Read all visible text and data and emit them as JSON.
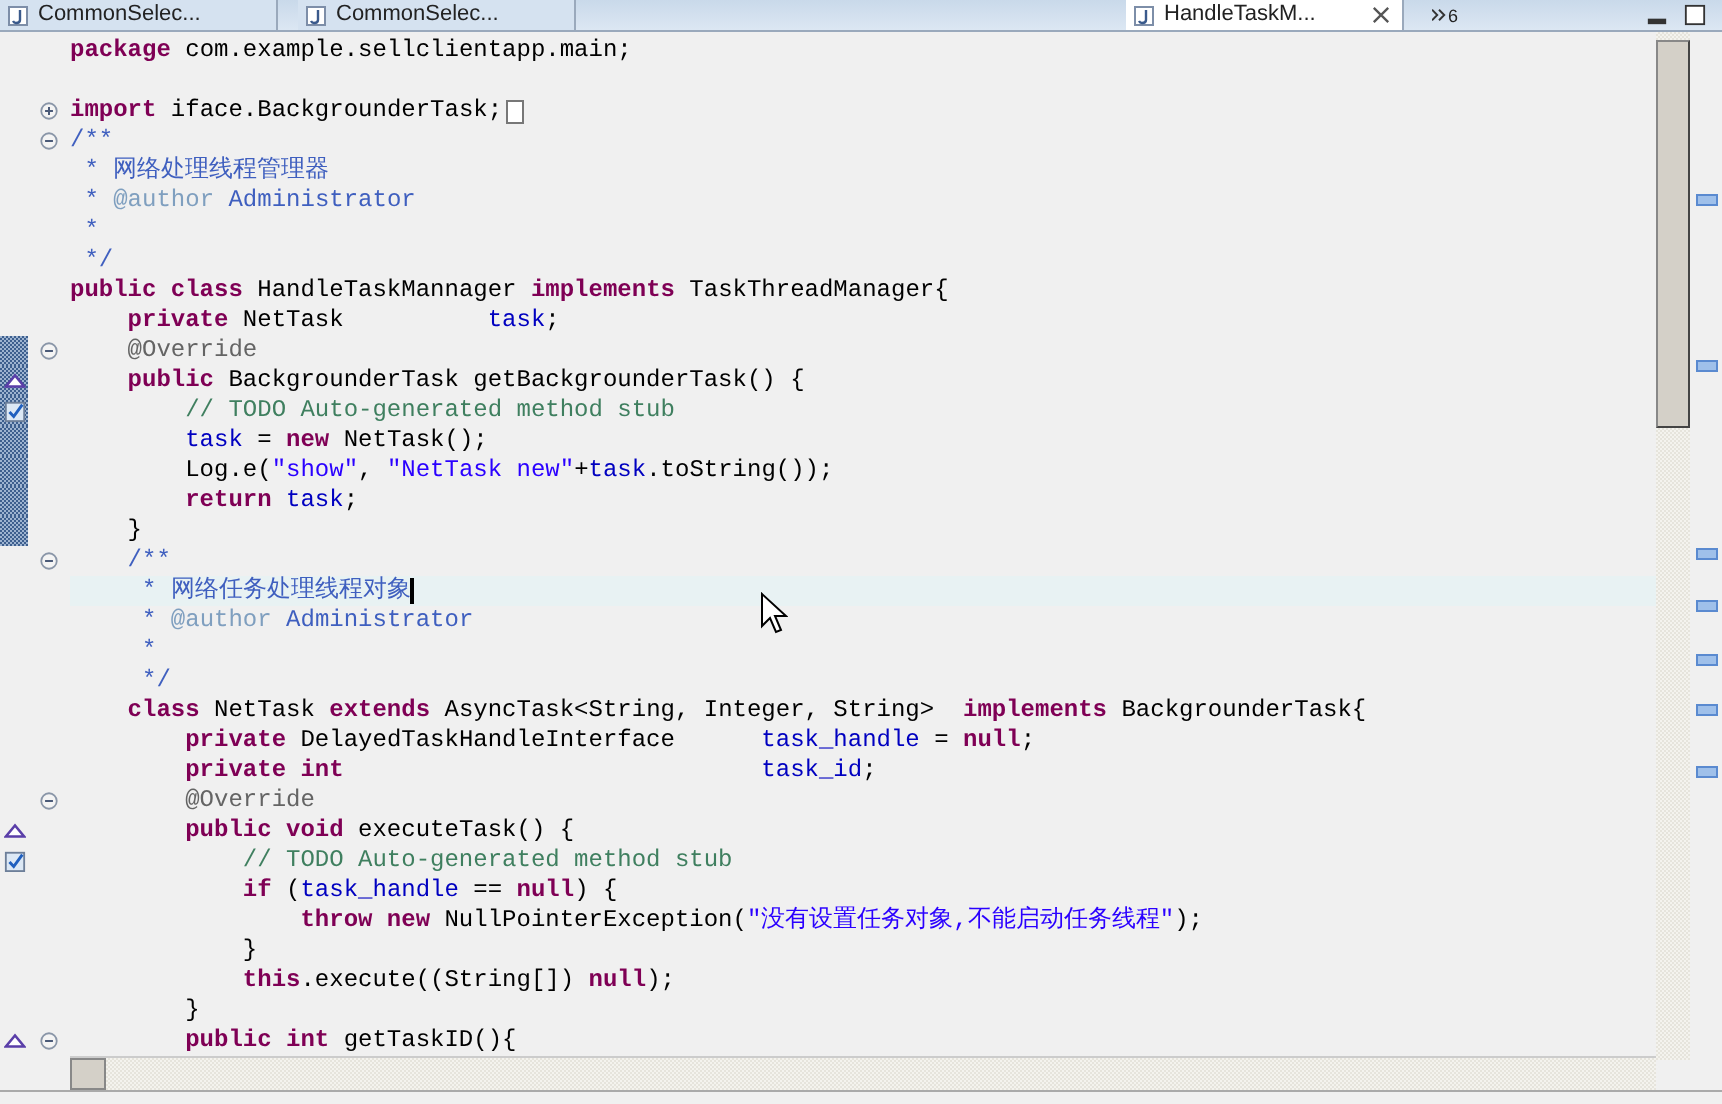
{
  "tabs": [
    {
      "label": "CommonSelec...",
      "selected": false
    },
    {
      "label": "CommonSelec...",
      "selected": false
    },
    {
      "label": "HandleTaskM...",
      "selected": true
    }
  ],
  "hidden_tab_count": "6",
  "lines": [
    {
      "changed": false,
      "current": false,
      "tokens": [
        {
          "kind": "kw",
          "text": "package"
        },
        {
          "kind": "plain",
          "text": " com.example.sellclientapp.main;"
        }
      ]
    },
    {
      "changed": false,
      "current": false
    },
    {
      "changed": false,
      "current": false,
      "folded": true,
      "tokens": [
        {
          "kind": "kw",
          "text": "import"
        },
        {
          "kind": "plain",
          "text": " iface.BackgrounderTask;"
        }
      ]
    },
    {
      "changed": false,
      "current": false,
      "folded": false,
      "tokens": [
        {
          "kind": "javadoc",
          "text": "/**"
        }
      ]
    },
    {
      "changed": false,
      "current": false,
      "tokens": [
        {
          "kind": "javadoc",
          "text": " * 网络处理线程管理器"
        }
      ]
    },
    {
      "changed": false,
      "current": false,
      "tokens": [
        {
          "kind": "javadoc",
          "text": " * "
        },
        {
          "kind": "tag",
          "text": "@author"
        },
        {
          "kind": "javadoc",
          "text": " Administrator"
        }
      ]
    },
    {
      "changed": false,
      "current": false,
      "tokens": [
        {
          "kind": "javadoc",
          "text": " *"
        }
      ]
    },
    {
      "changed": false,
      "current": false,
      "tokens": [
        {
          "kind": "javadoc",
          "text": " */"
        }
      ]
    },
    {
      "changed": false,
      "current": false,
      "tokens": [
        {
          "kind": "kw",
          "text": "public class"
        },
        {
          "kind": "plain",
          "text": " HandleTaskMannager "
        },
        {
          "kind": "kw",
          "text": "implements"
        },
        {
          "kind": "plain",
          "text": " TaskThreadManager{"
        }
      ]
    },
    {
      "changed": false,
      "current": false,
      "tokens": [
        {
          "kind": "kw",
          "text": "    private"
        },
        {
          "kind": "plain",
          "text": " NetTask          "
        },
        {
          "kind": "field",
          "text": "task"
        },
        {
          "kind": "plain",
          "text": ";"
        }
      ]
    },
    {
      "changed": true,
      "current": false,
      "folded": false,
      "tokens": [
        {
          "kind": "annotation",
          "text": "    @Override"
        }
      ]
    },
    {
      "changed": true,
      "current": false,
      "marker": {
        "kind": "override"
      },
      "tokens": [
        {
          "kind": "kw",
          "text": "    public"
        },
        {
          "kind": "plain",
          "text": " BackgrounderTask getBackgrounderTask() {"
        }
      ]
    },
    {
      "changed": true,
      "current": false,
      "marker": {
        "kind": "task"
      },
      "tokens": [
        {
          "kind": "comment",
          "text": "        // TODO Auto-generated method stub"
        }
      ]
    },
    {
      "changed": true,
      "current": false,
      "tokens": [
        {
          "kind": "field",
          "text": "        task"
        },
        {
          "kind": "plain",
          "text": " = "
        },
        {
          "kind": "kw",
          "text": "new"
        },
        {
          "kind": "plain",
          "text": " NetTask();"
        }
      ]
    },
    {
      "changed": true,
      "current": false,
      "tokens": [
        {
          "kind": "plain",
          "text": "        Log.e("
        },
        {
          "kind": "string",
          "text": "\"show\""
        },
        {
          "kind": "plain",
          "text": ", "
        },
        {
          "kind": "string",
          "text": "\"NetTask new\""
        },
        {
          "kind": "plain",
          "text": "+"
        },
        {
          "kind": "field",
          "text": "task"
        },
        {
          "kind": "plain",
          "text": ".toString());"
        }
      ]
    },
    {
      "changed": true,
      "current": false,
      "tokens": [
        {
          "kind": "kw",
          "text": "        return"
        },
        {
          "kind": "field",
          "text": " task"
        },
        {
          "kind": "plain",
          "text": ";"
        }
      ]
    },
    {
      "changed": true,
      "current": false,
      "tokens": [
        {
          "kind": "plain",
          "text": "    }"
        }
      ]
    },
    {
      "changed": false,
      "current": false,
      "folded": false,
      "tokens": [
        {
          "kind": "javadoc",
          "text": "    /**"
        }
      ]
    },
    {
      "changed": false,
      "current": true,
      "tokens": [
        {
          "kind": "javadoc",
          "text": "     * 网络任务处理线程对象"
        }
      ]
    },
    {
      "changed": false,
      "current": false,
      "tokens": [
        {
          "kind": "javadoc",
          "text": "     * "
        },
        {
          "kind": "tag",
          "text": "@author"
        },
        {
          "kind": "javadoc",
          "text": " Administrator"
        }
      ]
    },
    {
      "changed": false,
      "current": false,
      "tokens": [
        {
          "kind": "javadoc",
          "text": "     *"
        }
      ]
    },
    {
      "changed": false,
      "current": false,
      "tokens": [
        {
          "kind": "javadoc",
          "text": "     */"
        }
      ]
    },
    {
      "changed": false,
      "current": false,
      "tokens": [
        {
          "kind": "kw",
          "text": "    class"
        },
        {
          "kind": "plain",
          "text": " NetTask "
        },
        {
          "kind": "kw",
          "text": "extends"
        },
        {
          "kind": "plain",
          "text": " AsyncTask<String, Integer, String>  "
        },
        {
          "kind": "kw",
          "text": "implements"
        },
        {
          "kind": "plain",
          "text": " BackgrounderTask{"
        }
      ]
    },
    {
      "changed": false,
      "current": false,
      "tokens": [
        {
          "kind": "kw",
          "text": "        private"
        },
        {
          "kind": "plain",
          "text": " DelayedTaskHandleInterface      "
        },
        {
          "kind": "field",
          "text": "task_handle"
        },
        {
          "kind": "plain",
          "text": " = "
        },
        {
          "kind": "kw",
          "text": "null"
        },
        {
          "kind": "plain",
          "text": ";"
        }
      ]
    },
    {
      "changed": false,
      "current": false,
      "tokens": [
        {
          "kind": "kw",
          "text": "        private int"
        },
        {
          "kind": "field",
          "text": "                             task_id"
        },
        {
          "kind": "plain",
          "text": ";"
        }
      ]
    },
    {
      "changed": false,
      "current": false,
      "folded": false,
      "tokens": [
        {
          "kind": "annotation",
          "text": "        @Override"
        }
      ]
    },
    {
      "changed": false,
      "current": false,
      "marker": {
        "kind": "override"
      },
      "tokens": [
        {
          "kind": "kw",
          "text": "        public void"
        },
        {
          "kind": "plain",
          "text": " executeTask() {"
        }
      ]
    },
    {
      "changed": false,
      "current": false,
      "marker": {
        "kind": "task"
      },
      "tokens": [
        {
          "kind": "comment",
          "text": "            // TODO Auto-generated method stub"
        }
      ]
    },
    {
      "changed": false,
      "current": false,
      "tokens": [
        {
          "kind": "kw",
          "text": "            if"
        },
        {
          "kind": "plain",
          "text": " ("
        },
        {
          "kind": "field",
          "text": "task_handle"
        },
        {
          "kind": "plain",
          "text": " == "
        },
        {
          "kind": "kw",
          "text": "null"
        },
        {
          "kind": "plain",
          "text": ") {"
        }
      ]
    },
    {
      "changed": false,
      "current": false,
      "tokens": [
        {
          "kind": "kw",
          "text": "                throw new"
        },
        {
          "kind": "plain",
          "text": " NullPointerException("
        },
        {
          "kind": "string",
          "text": "\"没有设置任务对象,不能启动任务线程\""
        },
        {
          "kind": "plain",
          "text": ");"
        }
      ]
    },
    {
      "changed": false,
      "current": false,
      "tokens": [
        {
          "kind": "plain",
          "text": "            }"
        }
      ]
    },
    {
      "changed": false,
      "current": false,
      "tokens": [
        {
          "kind": "kw",
          "text": "            this"
        },
        {
          "kind": "plain",
          "text": ".execute((String[]) "
        },
        {
          "kind": "kw",
          "text": "null"
        },
        {
          "kind": "plain",
          "text": ");"
        }
      ]
    },
    {
      "changed": false,
      "current": false,
      "tokens": [
        {
          "kind": "plain",
          "text": "        }"
        }
      ]
    },
    {
      "changed": false,
      "current": false,
      "folded": false,
      "marker": {
        "kind": "override"
      },
      "tokens": [
        {
          "kind": "kw",
          "text": "        public int"
        },
        {
          "kind": "plain",
          "text": " getTaskID(){"
        }
      ]
    }
  ]
}
